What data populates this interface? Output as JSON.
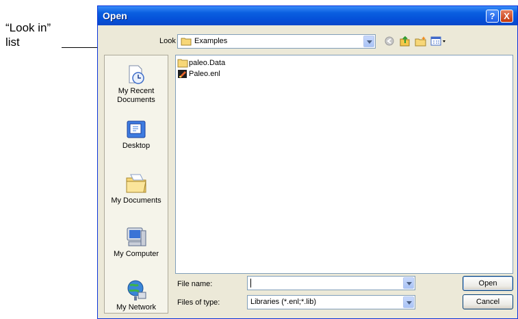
{
  "annotation": {
    "line1": "“Look in”",
    "line2": "list"
  },
  "window": {
    "title": "Open",
    "help_label": "?",
    "close_label": "X"
  },
  "lookin": {
    "label": "Look in:",
    "value": "Examples"
  },
  "toolbar": [
    "back-icon",
    "up-folder-icon",
    "new-folder-icon",
    "view-menu-icon"
  ],
  "places": [
    {
      "id": "recent",
      "label_line1": "My Recent",
      "label_line2": "Documents"
    },
    {
      "id": "desktop",
      "label_line1": "Desktop",
      "label_line2": ""
    },
    {
      "id": "mydocs",
      "label_line1": "My Documents",
      "label_line2": ""
    },
    {
      "id": "mycomputer",
      "label_line1": "My Computer",
      "label_line2": ""
    },
    {
      "id": "network",
      "label_line1": "My Network",
      "label_line2": ""
    }
  ],
  "files": [
    {
      "name": "paleo.Data",
      "icon": "folder-icon"
    },
    {
      "name": "Paleo.enl",
      "icon": "endnote-library-icon"
    }
  ],
  "filename": {
    "label": "File name:",
    "value": ""
  },
  "filetype": {
    "label": "Files of type:",
    "value": "Libraries (*.enl;*.lib)"
  },
  "buttons": {
    "open": "Open",
    "cancel": "Cancel"
  },
  "colors": {
    "title_bar": "#0550d8",
    "dialog_bg": "#ece9d8",
    "field_border": "#7f9db9"
  }
}
